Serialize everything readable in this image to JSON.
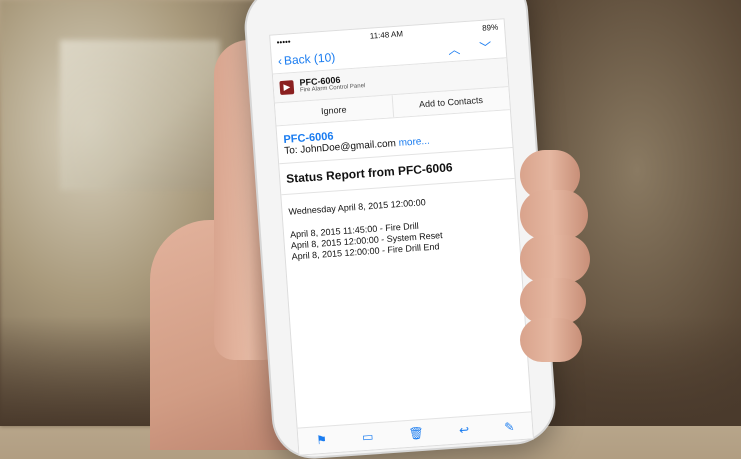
{
  "status": {
    "signal": "••••• ",
    "time": "11:48 AM",
    "battery": "89%"
  },
  "nav": {
    "back": "Back (10)",
    "up_icon": "chevron-up-icon",
    "down_icon": "chevron-down-icon"
  },
  "sender": {
    "name": "PFC-6006",
    "subtitle": "Fire Alarm Control Panel"
  },
  "actions": {
    "ignore": "Ignore",
    "add_to_contacts": "Add to Contacts"
  },
  "header": {
    "from": "PFC-6006",
    "to": "To: JohnDoe@gmail.com",
    "more": "more..."
  },
  "subject": "Status Report from PFC-6006",
  "body": {
    "date": "Wednesday April 8, 2015 12:00:00",
    "lines": [
      "April 8, 2015 11:45:00 - Fire Drill",
      "April 8, 2015 12:00:00 - System Reset",
      "April 8, 2015 12:00:00 - Fire Drill End"
    ]
  },
  "toolbar": {
    "icons": [
      "flag-icon",
      "folder-icon",
      "trash-icon",
      "reply-icon",
      "compose-icon"
    ]
  },
  "colors": {
    "accent": "#1a7cf0"
  }
}
